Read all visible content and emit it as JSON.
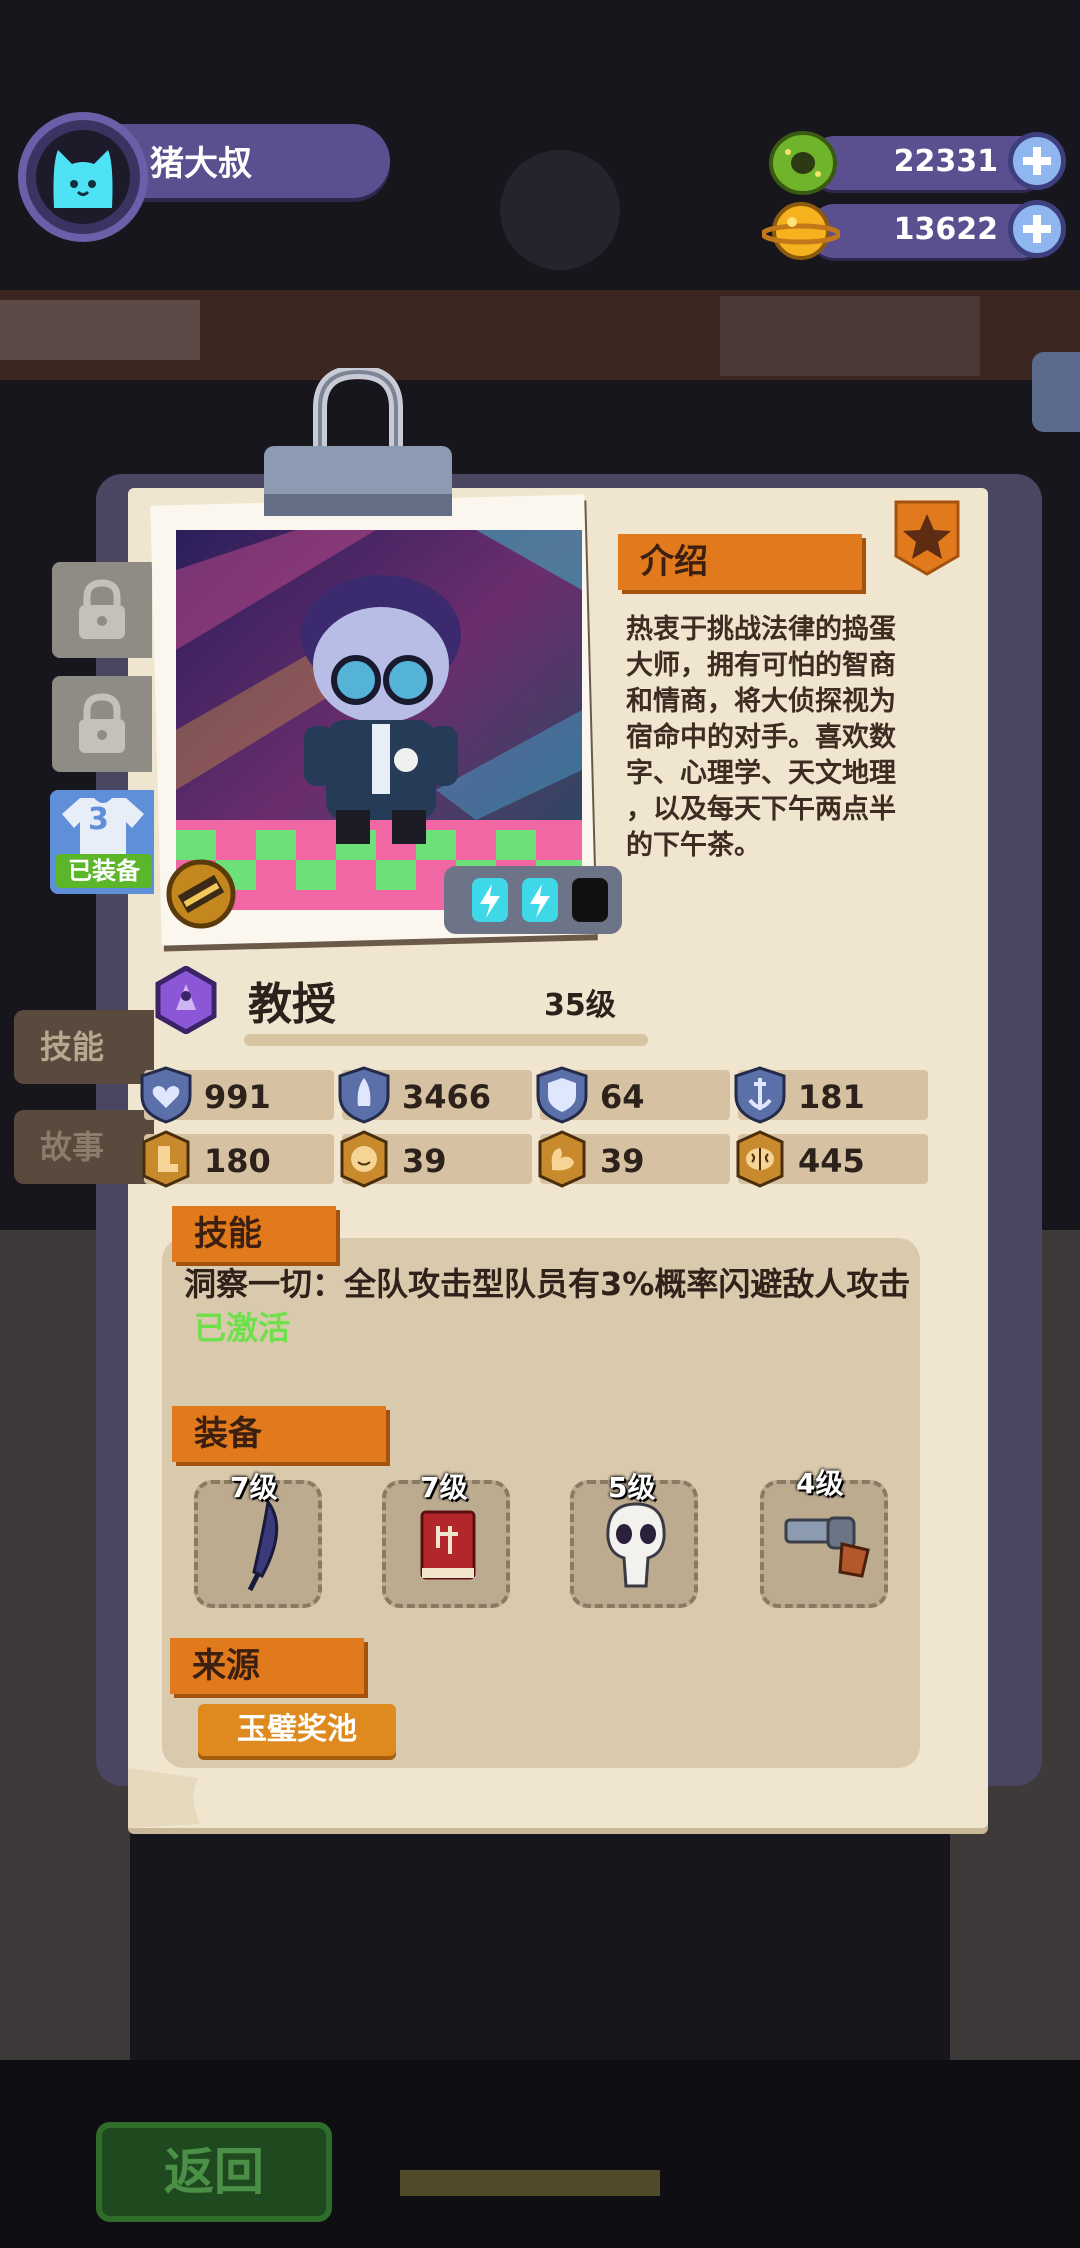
{
  "player": {
    "name": "猪大叔",
    "avatar_icon": "cat-face-icon"
  },
  "currencies": [
    {
      "icon": "donut-coin-icon",
      "value": "22331"
    },
    {
      "icon": "planet-gem-icon",
      "value": "13622"
    }
  ],
  "character": {
    "intro_tag": "介绍",
    "description": "热衷于挑战法律的捣蛋\n大师，拥有可怕的智商\n和情商，将大侦探视为\n宿命中的对手。喜欢数\n字、心理学、天文地理\n，以及每天下午两点半\n的下午茶。",
    "class_icon": "purple-rank-icon",
    "name": "教授",
    "level": "35级",
    "star_icon": "star-badge-icon",
    "energy_slots": [
      "lightning-icon",
      "lightning-icon",
      "empty-slot-icon"
    ],
    "stats": [
      {
        "icon": "heart-shield-icon",
        "value": "991"
      },
      {
        "icon": "rocket-shield-icon",
        "value": "3466"
      },
      {
        "icon": "shield-icon",
        "value": "64"
      },
      {
        "icon": "anchor-shield-icon",
        "value": "181"
      },
      {
        "icon": "boot-badge-icon",
        "value": "180"
      },
      {
        "icon": "face-badge-icon",
        "value": "39"
      },
      {
        "icon": "muscle-badge-icon",
        "value": "39"
      },
      {
        "icon": "brain-badge-icon",
        "value": "445"
      }
    ]
  },
  "outfit": {
    "count": "3",
    "equipped_label": "已装备"
  },
  "side_tabs": [
    "技能",
    "故事"
  ],
  "skill": {
    "tag": "技能",
    "text": "洞察一切：全队攻击型队员有3%概率闪避敌人攻击",
    "status": "已激活"
  },
  "equipment": {
    "tag": "装备",
    "items": [
      {
        "icon": "umbrella-icon",
        "level": "7级"
      },
      {
        "icon": "red-book-icon",
        "level": "7级"
      },
      {
        "icon": "skull-icon",
        "level": "5级"
      },
      {
        "icon": "revolver-icon",
        "level": "4级"
      }
    ]
  },
  "source": {
    "tag": "来源",
    "button": "玉璧奖池"
  },
  "back_button": "返回",
  "colors": {
    "accent_orange": "#e07a1c",
    "paper": "#f0e5cf",
    "hud_purple": "#5a4f8f",
    "activated_green": "#6ee04a"
  }
}
